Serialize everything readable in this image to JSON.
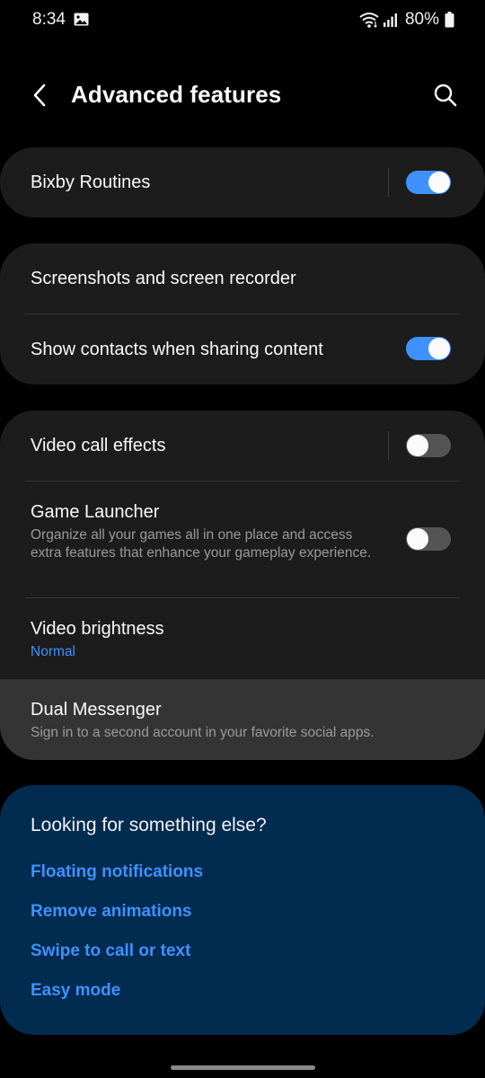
{
  "status_bar": {
    "time": "8:34",
    "battery": "80%"
  },
  "header": {
    "title": "Advanced features"
  },
  "cards": {
    "bixby": {
      "title": "Bixby Routines",
      "toggle_on": true
    },
    "sharing": {
      "screenshots": "Screenshots and screen recorder",
      "contacts": "Show contacts when sharing content",
      "contacts_toggle_on": true
    },
    "media": {
      "video_call": "Video call effects",
      "video_call_toggle_on": false,
      "game_launcher": "Game Launcher",
      "game_launcher_sub": "Organize all your games all in one place and access extra features that enhance your gameplay experience.",
      "game_launcher_toggle_on": false,
      "video_brightness": "Video brightness",
      "video_brightness_value": "Normal",
      "dual_messenger": "Dual Messenger",
      "dual_messenger_sub": "Sign in to a second account in your favorite social apps."
    }
  },
  "suggestions": {
    "heading": "Looking for something else?",
    "links": [
      "Floating notifications",
      "Remove animations",
      "Swipe to call or text",
      "Easy mode"
    ]
  },
  "colors": {
    "accent": "#3e91ff",
    "card": "#1c1c1c",
    "suggest_card": "#012b4f"
  }
}
